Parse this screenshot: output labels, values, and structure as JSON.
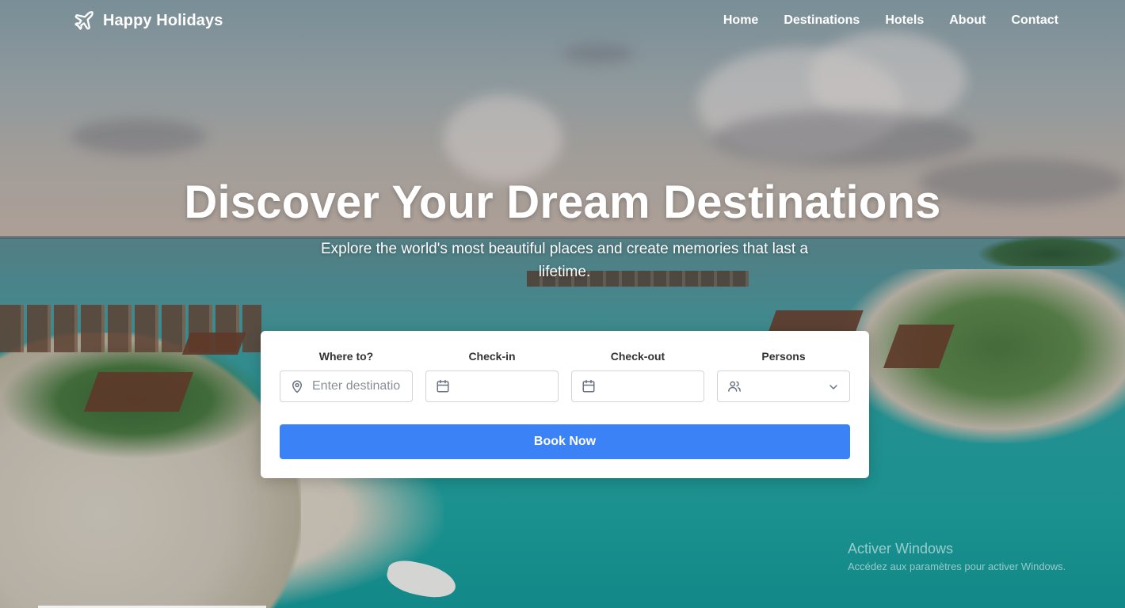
{
  "nav": {
    "brand_name": "Happy Holidays",
    "brand_icon": "airplane-icon",
    "links": [
      "Home",
      "Destinations",
      "Hotels",
      "About",
      "Contact"
    ]
  },
  "hero": {
    "title": "Discover Your Dream Destinations",
    "subtitle": "Explore the world's most beautiful places and create memories that last a lifetime."
  },
  "booking": {
    "where": {
      "label": "Where to?",
      "placeholder": "Enter destination",
      "icon": "map-pin-icon"
    },
    "checkin": {
      "label": "Check-in",
      "icon": "calendar-icon"
    },
    "checkout": {
      "label": "Check-out",
      "icon": "calendar-icon"
    },
    "persons": {
      "label": "Persons",
      "icon": "users-icon"
    },
    "button_label": "Book Now"
  },
  "watermark": {
    "title": "Activer Windows",
    "subtitle": "Accédez aux paramètres pour activer Windows."
  },
  "colors": {
    "accent": "#3b82f6",
    "card_bg": "#ffffff",
    "text_light": "#ffffff"
  }
}
